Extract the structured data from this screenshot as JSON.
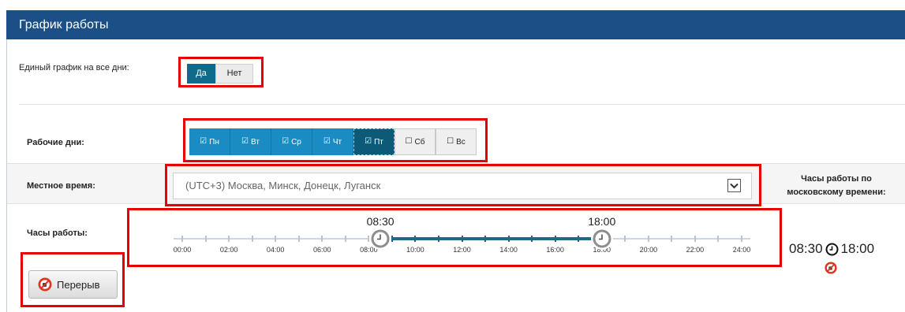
{
  "header": {
    "title": "График работы"
  },
  "unified_schedule": {
    "label": "Единый график на все дни:",
    "options": [
      {
        "label": "Да",
        "selected": true
      },
      {
        "label": "Нет",
        "selected": false
      }
    ]
  },
  "work_days": {
    "label": "Рабочие дни:",
    "days": [
      {
        "label": "Пн",
        "checked": true
      },
      {
        "label": "Вт",
        "checked": true
      },
      {
        "label": "Ср",
        "checked": true
      },
      {
        "label": "Чт",
        "checked": true
      },
      {
        "label": "Пт",
        "checked": true,
        "focused": true
      },
      {
        "label": "Сб",
        "checked": false
      },
      {
        "label": "Вс",
        "checked": false
      }
    ],
    "icons": {
      "checked": "checked-box-icon",
      "unchecked": "unchecked-box-icon"
    }
  },
  "local_time": {
    "label": "Местное время:",
    "value": "(UTC+3) Москва, Минск, Донецк, Луганск",
    "icon": "dropdown-arrow-icon"
  },
  "moscow_time": {
    "label": "Часы работы по московскому времени:",
    "start": "08:30",
    "end": "18:00",
    "icons": [
      "clock-icon",
      "break-icon"
    ]
  },
  "work_hours": {
    "label": "Часы работы:",
    "start": "08:30",
    "end": "18:00",
    "ticks": [
      "00:00",
      "02:00",
      "04:00",
      "06:00",
      "08:00",
      "10:00",
      "12:00",
      "14:00",
      "16:00",
      "18:00",
      "20:00",
      "22:00",
      "24:00"
    ],
    "handle_icon": "clock-icon"
  },
  "break_button": {
    "label": "Перерыв",
    "icon": "break-icon"
  },
  "colors": {
    "header": "#1b4f86",
    "selected": "#0f6a8c",
    "checked": "#1a8bc3",
    "focused": "#0c5a78",
    "range": "#1e6a84",
    "track": "#cdd6e4",
    "highlight": "#e60000"
  }
}
